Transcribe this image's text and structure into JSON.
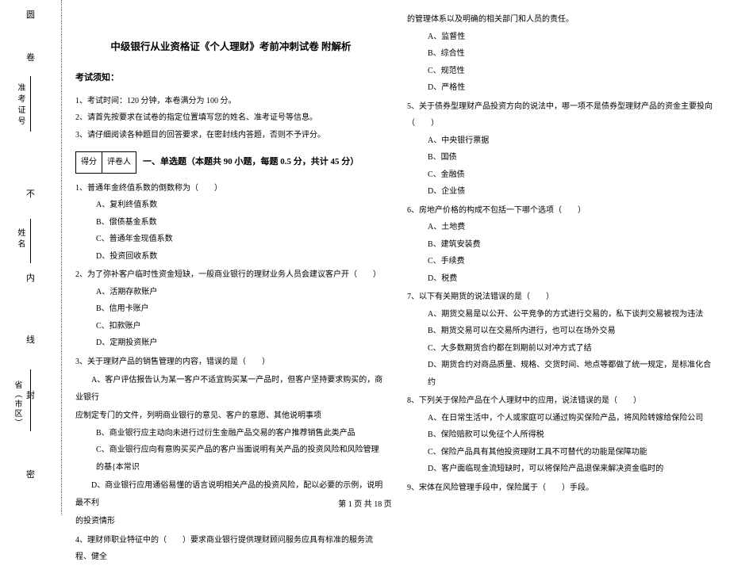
{
  "binding": {
    "char_top": "圆",
    "field1_label": "准考证号",
    "char_mid1": "卷",
    "char_nb": "不",
    "field2_label": "姓名",
    "char_nei": "内",
    "char_xian": "线",
    "field3_label": "省（市区）",
    "char_feng": "封",
    "char_mi": "密"
  },
  "title": "中级银行从业资格证《个人理财》考前冲刺试卷 附解析",
  "notice_heading": "考试须知：",
  "notices": [
    "1、考试时间：120 分钟，本卷满分为 100 分。",
    "2、请首先按要求在试卷的指定位置填写您的姓名、准考证号等信息。",
    "3、请仔细阅读各种题目的回答要求，在密封线内答题，否则不予评分。"
  ],
  "scorebox": {
    "a": "得分",
    "b": "评卷人"
  },
  "section1_heading": "一、单选题（本题共 90 小题，每题 0.5 分，共计 45 分）",
  "left_body": [
    {
      "cls": "q",
      "t": "1、普通年金终值系数的倒数称为（　　）"
    },
    {
      "cls": "opt",
      "t": "A、复利终值系数"
    },
    {
      "cls": "opt",
      "t": "B、偿债基金系数"
    },
    {
      "cls": "opt",
      "t": "C、普通年金现值系数"
    },
    {
      "cls": "opt",
      "t": "D、投资回收系数"
    },
    {
      "cls": "q",
      "t": "2、为了弥补客户临时性资金短缺，一般商业银行的理财业务人员会建议客户开（　　）"
    },
    {
      "cls": "opt",
      "t": "A、活期存款账户"
    },
    {
      "cls": "opt",
      "t": "B、信用卡账户"
    },
    {
      "cls": "opt",
      "t": "C、扣款账户"
    },
    {
      "cls": "opt",
      "t": "D、定期投资账户"
    },
    {
      "cls": "q",
      "t": "3、关于理财产品的销售管理的内容，错误的是（　　）"
    },
    {
      "cls": "q",
      "t": "　　A、客户评估报告认为某一客户不适宜购买某一产品时，但客户坚持要求购买的，商业银行"
    },
    {
      "cls": "q",
      "t": "应制定专门的文件，列明商业银行的意见、客户的意愿、其他说明事项"
    },
    {
      "cls": "opt",
      "t": "B、商业银行应主动向未进行过衍生金融产品交易的客户推荐销售此类产品"
    },
    {
      "cls": "opt",
      "t": "C、商业银行应向有意购买买产品的客户当面说明有关产品的投资风险和风险管理的基{本常识"
    },
    {
      "cls": "q",
      "t": "　　D、商业银行应用通俗易懂的语言说明相关产品的投资风险，配以必要的示例，说明最不利"
    },
    {
      "cls": "q",
      "t": "的投资情形"
    },
    {
      "cls": "q",
      "t": "4、理财师职业特征中的（　　）要求商业银行提供理财顾问服务应具有标准的服务流程、健全"
    }
  ],
  "right_body": [
    {
      "cls": "q",
      "t": "的管理体系以及明确的相关部门和人员的责任。"
    },
    {
      "cls": "opt",
      "t": "A、监督性"
    },
    {
      "cls": "opt",
      "t": "B、综合性"
    },
    {
      "cls": "opt",
      "t": "C、规范性"
    },
    {
      "cls": "opt",
      "t": "D、严格性"
    },
    {
      "cls": "q",
      "t": "5、关于债券型理财产品投资方向的说法中，哪一项不是债券型理财产品的资金主要投向（　　）"
    },
    {
      "cls": "opt",
      "t": "A、中央银行票据"
    },
    {
      "cls": "opt",
      "t": "B、国债"
    },
    {
      "cls": "opt",
      "t": "C、金融债"
    },
    {
      "cls": "opt",
      "t": "D、企业债"
    },
    {
      "cls": "q",
      "t": "6、房地产价格的构成不包括一下哪个选项（　　）"
    },
    {
      "cls": "opt",
      "t": "A、土地费"
    },
    {
      "cls": "opt",
      "t": "B、建筑安装费"
    },
    {
      "cls": "opt",
      "t": "C、手续费"
    },
    {
      "cls": "opt",
      "t": "D、税费"
    },
    {
      "cls": "q",
      "t": "7、以下有关期货的说法错误的是（　　）"
    },
    {
      "cls": "opt",
      "t": "A、期货交易是以公开、公平竞争的方式进行交易的，私下谈判交易被视为违法"
    },
    {
      "cls": "opt",
      "t": "B、期货交易可以在交易所内进行，也可以在场外交易"
    },
    {
      "cls": "opt",
      "t": "C、大多数期货合约都在到期前以对冲方式了结"
    },
    {
      "cls": "opt",
      "t": "D、期货合约对商品质量、规格、交货时间、地点等都做了统一规定，是标准化合约"
    },
    {
      "cls": "q",
      "t": "8、下列关于保险产品在个人理财中的应用，说法错误的是（　　）"
    },
    {
      "cls": "opt",
      "t": "A、在日常生活中，个人或家庭可以通过购买保险产品，将风险转嫁给保险公司"
    },
    {
      "cls": "opt",
      "t": "B、保险赔款可以免征个人所得税"
    },
    {
      "cls": "opt",
      "t": "C、保险产品具有其他投资理财工具不可替代的功能是保障功能"
    },
    {
      "cls": "opt",
      "t": "D、客户面临现金流短缺时，可以将保险产品退保来解决资金临时的"
    },
    {
      "cls": "q",
      "t": "9、宋体在风险管理手段中，保险属于（　　）手段。"
    }
  ],
  "footer": "第 1 页 共 18 页"
}
